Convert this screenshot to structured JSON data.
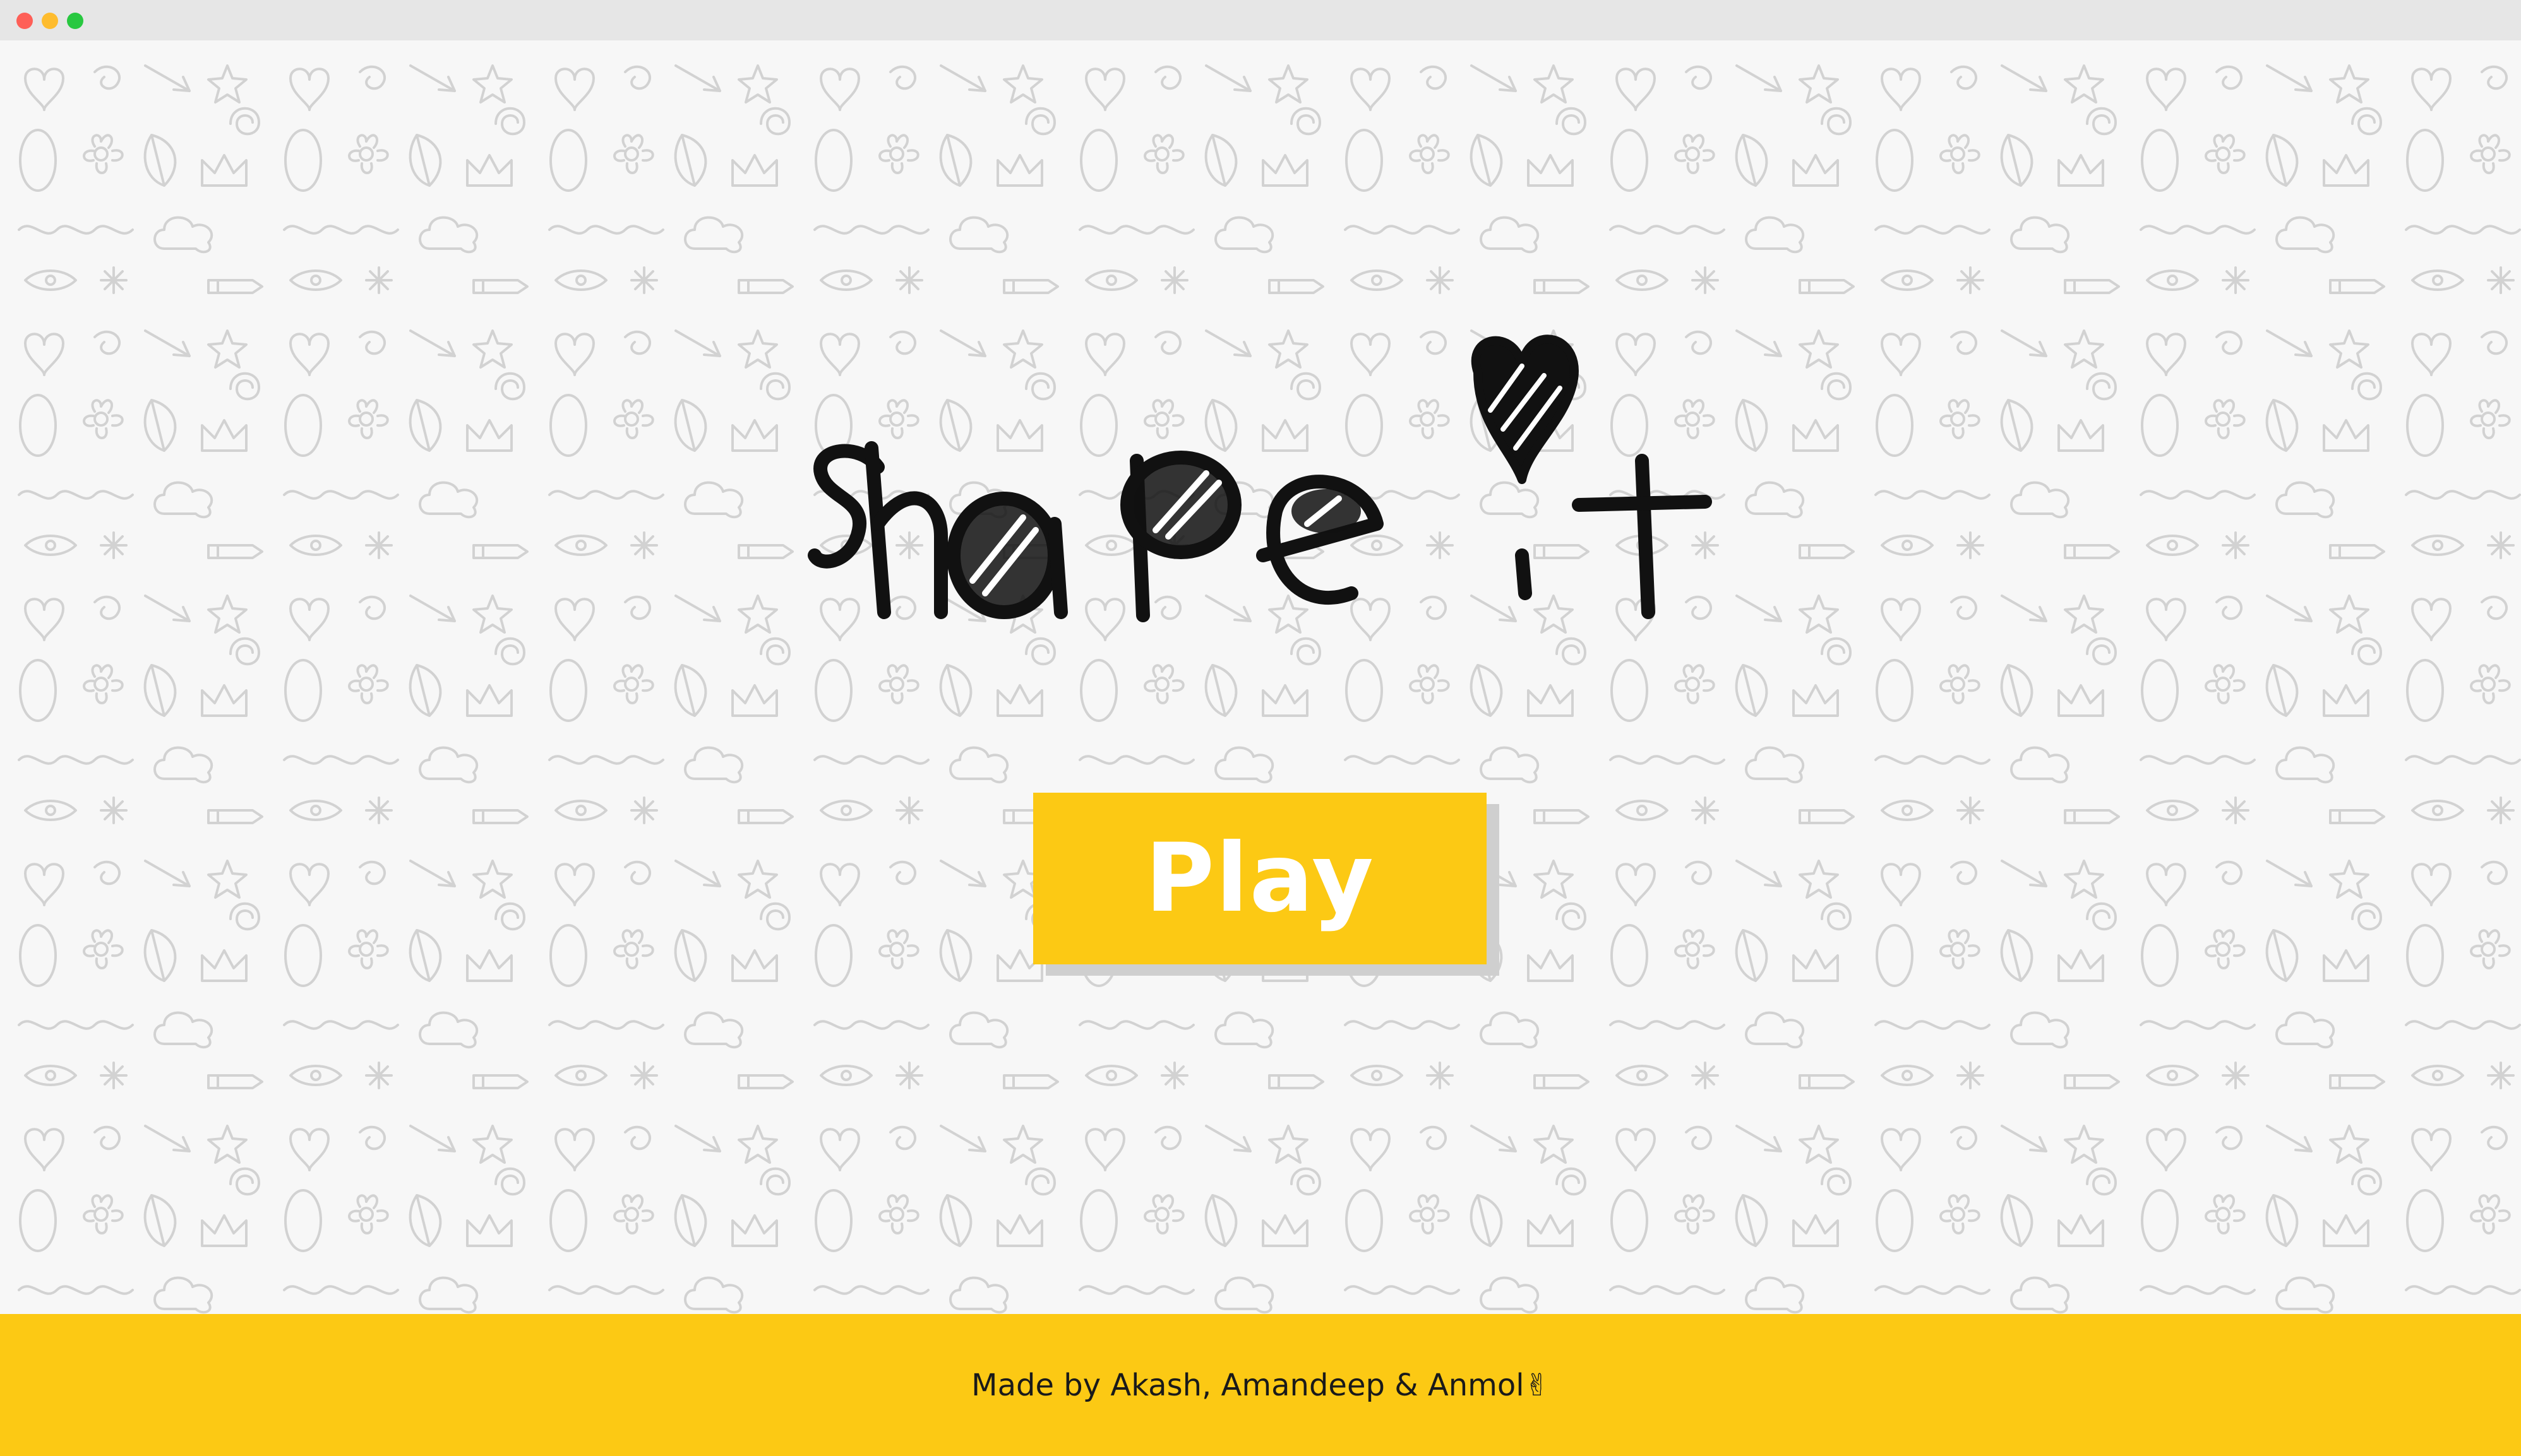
{
  "app": {
    "title": "shape it"
  },
  "colors": {
    "accent": "#fcc914",
    "background": "#f7f7f7",
    "doodle": "#d2d2d2",
    "ink": "#111111",
    "button_text": "#ffffff"
  },
  "main": {
    "play_label": "Play"
  },
  "footer": {
    "credit": "Made by Akash, Amandeep & Anmol✌"
  },
  "icons": {
    "logo_heart": "heart-icon",
    "window_controls": [
      "close-icon",
      "minimize-icon",
      "maximize-icon"
    ]
  }
}
